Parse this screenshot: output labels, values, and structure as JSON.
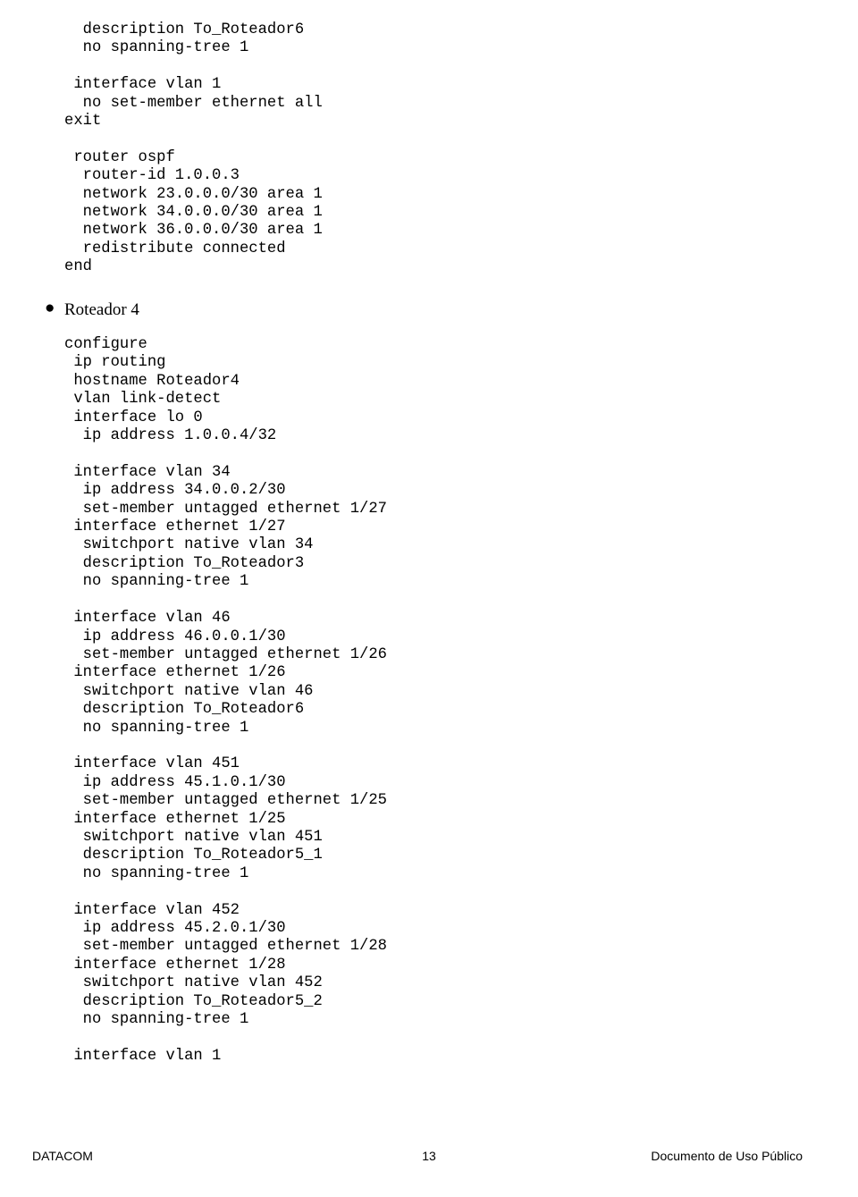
{
  "code_block_1": "  description To_Roteador6\n  no spanning-tree 1\n\n interface vlan 1\n  no set-member ethernet all\nexit\n\n router ospf\n  router-id 1.0.0.3\n  network 23.0.0.0/30 area 1\n  network 34.0.0.0/30 area 1\n  network 36.0.0.0/30 area 1\n  redistribute connected\nend",
  "bullet_heading": "Roteador 4",
  "code_block_2": "configure\n ip routing\n hostname Roteador4\n vlan link-detect\n interface lo 0\n  ip address 1.0.0.4/32\n\n interface vlan 34\n  ip address 34.0.0.2/30\n  set-member untagged ethernet 1/27\n interface ethernet 1/27\n  switchport native vlan 34\n  description To_Roteador3\n  no spanning-tree 1\n\n interface vlan 46\n  ip address 46.0.0.1/30\n  set-member untagged ethernet 1/26\n interface ethernet 1/26\n  switchport native vlan 46\n  description To_Roteador6\n  no spanning-tree 1\n\n interface vlan 451\n  ip address 45.1.0.1/30\n  set-member untagged ethernet 1/25\n interface ethernet 1/25\n  switchport native vlan 451\n  description To_Roteador5_1\n  no spanning-tree 1\n\n interface vlan 452\n  ip address 45.2.0.1/30\n  set-member untagged ethernet 1/28\n interface ethernet 1/28\n  switchport native vlan 452\n  description To_Roteador5_2\n  no spanning-tree 1\n\n interface vlan 1",
  "footer": {
    "left": "DATACOM",
    "center": "13",
    "right": "Documento de Uso Público"
  }
}
